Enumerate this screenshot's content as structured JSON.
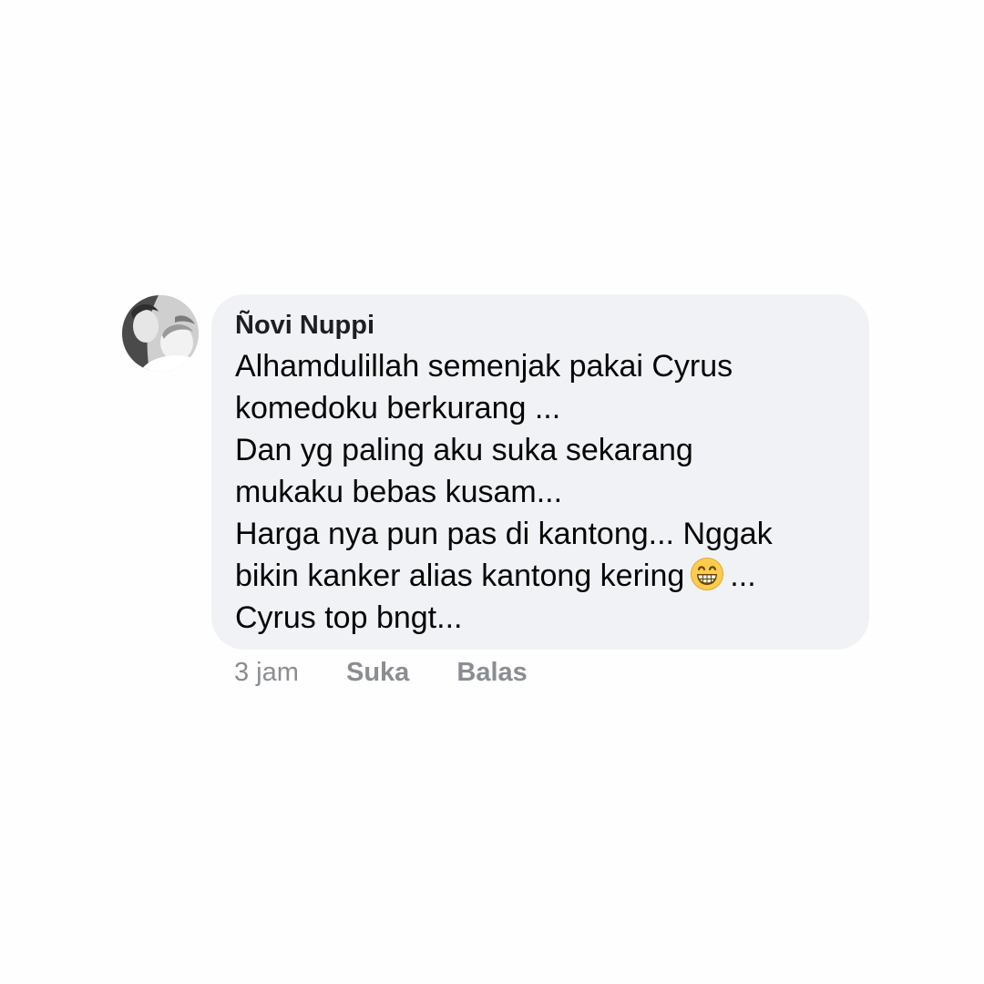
{
  "comment": {
    "author": "Ñovi Nuppi",
    "lines": [
      {
        "text": "Alhamdulillah semenjak pakai Cyrus"
      },
      {
        "text": "komedoku berkurang ..."
      },
      {
        "text": "Dan yg paling aku suka sekarang"
      },
      {
        "text": "mukaku bebas kusam..."
      },
      {
        "text": "Harga nya pun pas di kantong... Nggak"
      },
      {
        "text": "bikin kanker alias kantong kering",
        "emoji": "grinning-face-emoji",
        "after": "..."
      },
      {
        "text": "Cyrus top bngt..."
      }
    ],
    "timestamp": "3 jam",
    "like_label": "Suka",
    "reply_label": "Balas"
  },
  "colors": {
    "bubble_background": "#f0f2f5",
    "author_text": "#1c1e21",
    "comment_text": "#050505",
    "action_text": "#8a8d91",
    "emoji_face": "#ffcc4d"
  }
}
